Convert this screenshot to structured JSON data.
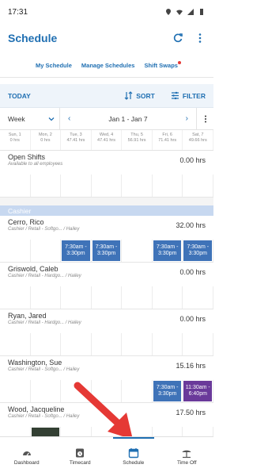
{
  "status_bar": {
    "time": "17:31"
  },
  "header": {
    "title": "Schedule"
  },
  "subnav": {
    "items": [
      {
        "label": "My Schedule"
      },
      {
        "label": "Manage Schedules"
      },
      {
        "label": "Shift Swaps"
      }
    ]
  },
  "actionbar": {
    "today": "TODAY",
    "sort": "SORT",
    "filter": "FILTER"
  },
  "weekbar": {
    "period": "Week",
    "range": "Jan 1 - Jan 7",
    "prev": "‹",
    "next": "›"
  },
  "days": [
    {
      "label": "Sun, 1",
      "hrs": "0 hrs"
    },
    {
      "label": "Mon, 2",
      "hrs": "0 hrs"
    },
    {
      "label": "Tue, 3",
      "hrs": "47.41 hrs"
    },
    {
      "label": "Wed, 4",
      "hrs": "47.41 hrs"
    },
    {
      "label": "Thu, 5",
      "hrs": "56.91 hrs"
    },
    {
      "label": "Fri, 6",
      "hrs": "71.41 hrs"
    },
    {
      "label": "Sat, 7",
      "hrs": "49.66 hrs"
    }
  ],
  "open_shifts": {
    "name": "Open Shifts",
    "sub": "Available to all employees",
    "hours": "0.00 hrs"
  },
  "section": {
    "label": "Cashier"
  },
  "employees": [
    {
      "name": "Cerro, Rico",
      "sub": "Cashier / Retail - Softgo... / Hailey",
      "hours": "32.00 hrs"
    },
    {
      "name": "Griswold, Caleb",
      "sub": "Cashier / Retail - Hardgo... / Hailey",
      "hours": "0.00 hrs"
    },
    {
      "name": "Ryan, Jared",
      "sub": "Cashier / Retail - Hardgo... / Hailey",
      "hours": "0.00 hrs"
    },
    {
      "name": "Washington, Sue",
      "sub": "Cashier / Retail - Softgo... / Hailey",
      "hours": "15.16 hrs"
    },
    {
      "name": "Wood, Jacqueline",
      "sub": "Cashier / Retail - Softgo... / Hailey",
      "hours": "17.50 hrs"
    }
  ],
  "shifts": {
    "s730_330": "7:30am - 3:30pm",
    "s1130_640": "11:30am - 6:40pm"
  },
  "bottom_nav": [
    {
      "label": "Dashboard",
      "icon": "gauge-icon"
    },
    {
      "label": "Timecard",
      "icon": "timecard-icon"
    },
    {
      "label": "Schedule",
      "icon": "calendar-icon"
    },
    {
      "label": "Time Off",
      "icon": "beach-icon"
    }
  ],
  "colors": {
    "accent": "#1f6fb2",
    "shift_blue": "#3f73b8",
    "shift_purple": "#6a3a9a",
    "arrow": "#e53935"
  }
}
